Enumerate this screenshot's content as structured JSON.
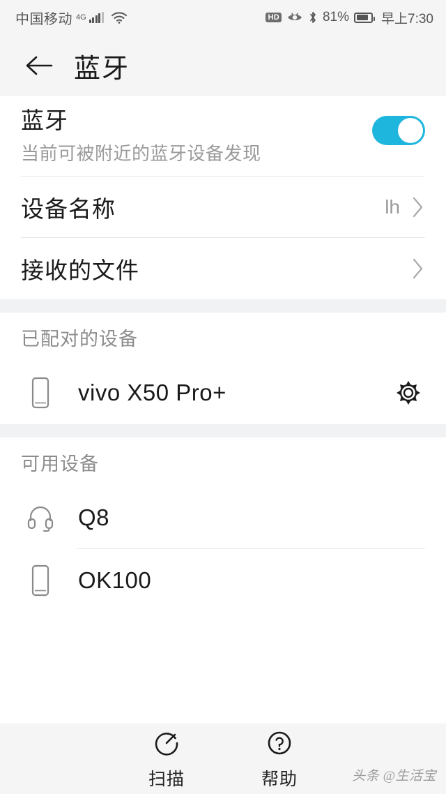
{
  "status_bar": {
    "carrier": "中国移动",
    "network_type": "4G",
    "signal_icon": "signal-bars-icon",
    "wifi_icon": "wifi-icon",
    "hd_badge": "HD",
    "eye_icon": "eye-comfort-icon",
    "bluetooth_icon": "bluetooth-icon",
    "battery_percent": "81%",
    "battery_icon": "battery-icon",
    "battery_level": 81,
    "time": "早上7:30"
  },
  "app_bar": {
    "back_icon": "back-arrow-icon",
    "title": "蓝牙"
  },
  "bluetooth_master": {
    "title": "蓝牙",
    "subtitle": "当前可被附近的蓝牙设备发现",
    "toggle_icon": "toggle-switch-on",
    "toggle_on": true,
    "accent_color": "#1fb6dd"
  },
  "settings_rows": [
    {
      "label": "设备名称",
      "value": "lh",
      "chevron_icon": "chevron-right-icon"
    },
    {
      "label": "接收的文件",
      "value": "",
      "chevron_icon": "chevron-right-icon"
    }
  ],
  "paired_section": {
    "header": "已配对的设备",
    "devices": [
      {
        "name": "vivo X50 Pro+",
        "device_icon": "phone-icon",
        "settings_icon": "gear-icon"
      }
    ]
  },
  "available_section": {
    "header": "可用设备",
    "devices": [
      {
        "name": "Q8",
        "device_icon": "headphones-icon"
      },
      {
        "name": "OK100",
        "device_icon": "phone-icon"
      }
    ]
  },
  "bottom_bar": {
    "items": [
      {
        "label": "扫描",
        "icon": "scan-refresh-icon"
      },
      {
        "label": "帮助",
        "icon": "question-circle-icon"
      }
    ],
    "watermark": "头条 @生活宝"
  }
}
